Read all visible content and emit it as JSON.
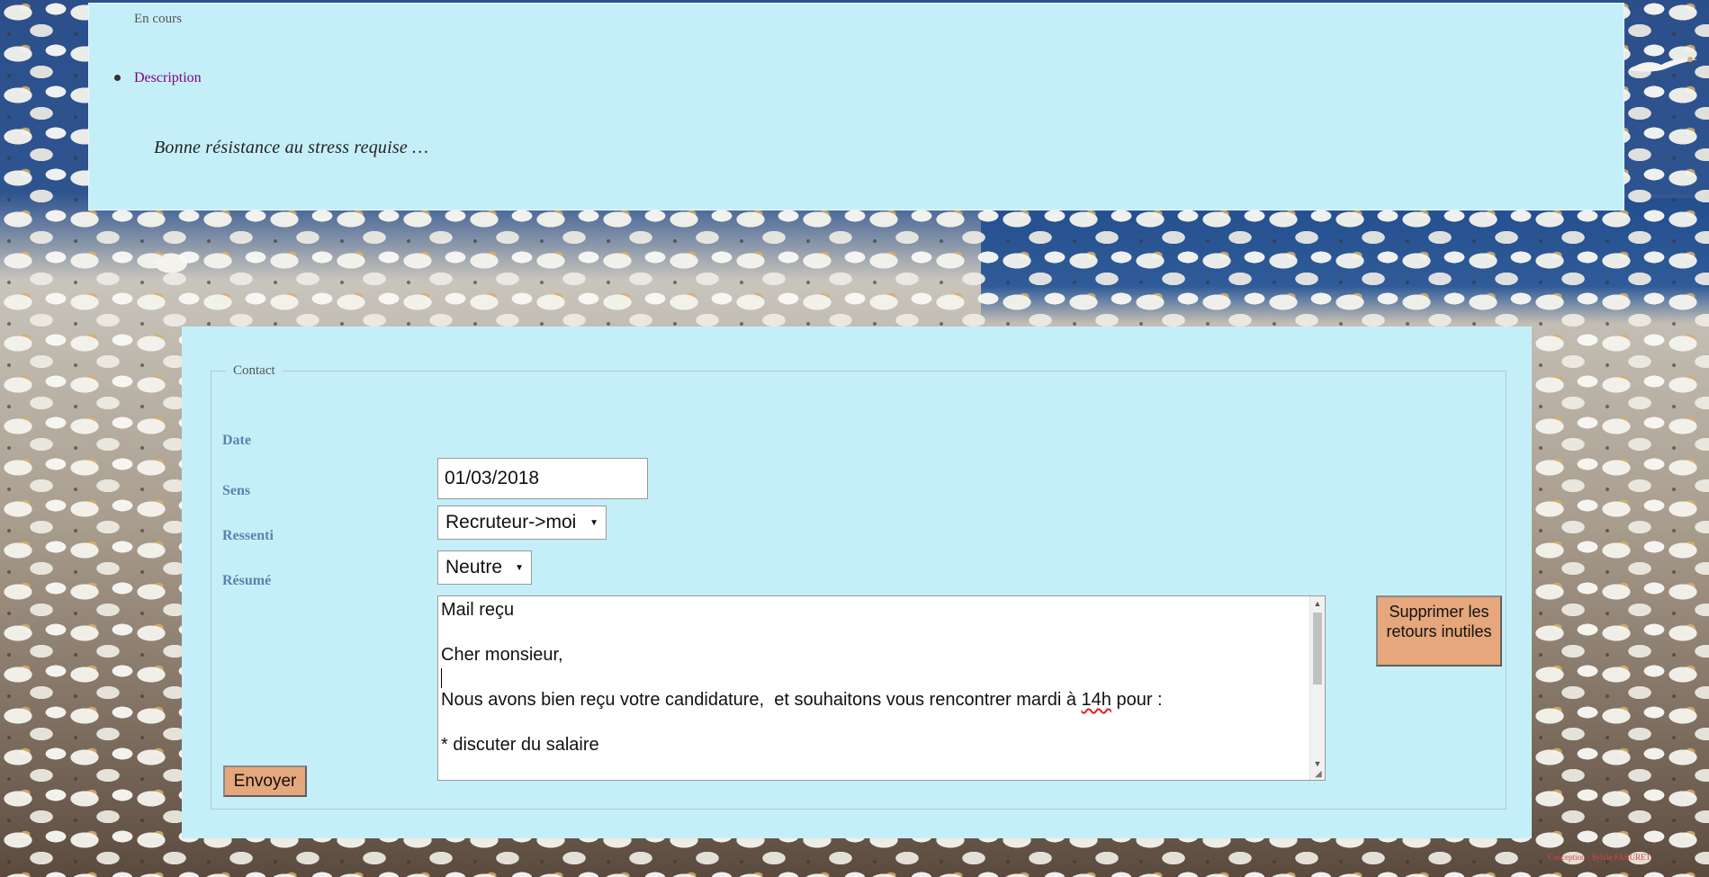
{
  "job": {
    "status": "En cours",
    "description_link": "Description",
    "description_text": "Bonne résistance au stress requise …"
  },
  "contact_form": {
    "legend": "Contact",
    "date_label": "Date",
    "date_value": "01/03/2018",
    "sens_label": "Sens",
    "sens_value": "Recruteur->moi",
    "ressenti_label": "Ressenti",
    "ressenti_value": "Neutre",
    "resume_label": "Résumé",
    "resume_lines": {
      "l1": "Mail reçu",
      "l2": "Cher monsieur,",
      "l3_before": "Nous avons bien reçu votre candidature,  et souhaitons vous rencontrer mardi à ",
      "l3_spell": "14h",
      "l3_after": " pour :",
      "l4": "* discuter du salaire"
    },
    "delete_button": "Supprimer les retours inutiles",
    "send_button": "Envoyer"
  },
  "footer": {
    "credits": "Conception : Sylvie FABURET"
  },
  "colors": {
    "panel_bg": "#c5eff8",
    "button_bg": "#e5a77b",
    "label": "#5b82b0",
    "link_visited": "#800080"
  }
}
